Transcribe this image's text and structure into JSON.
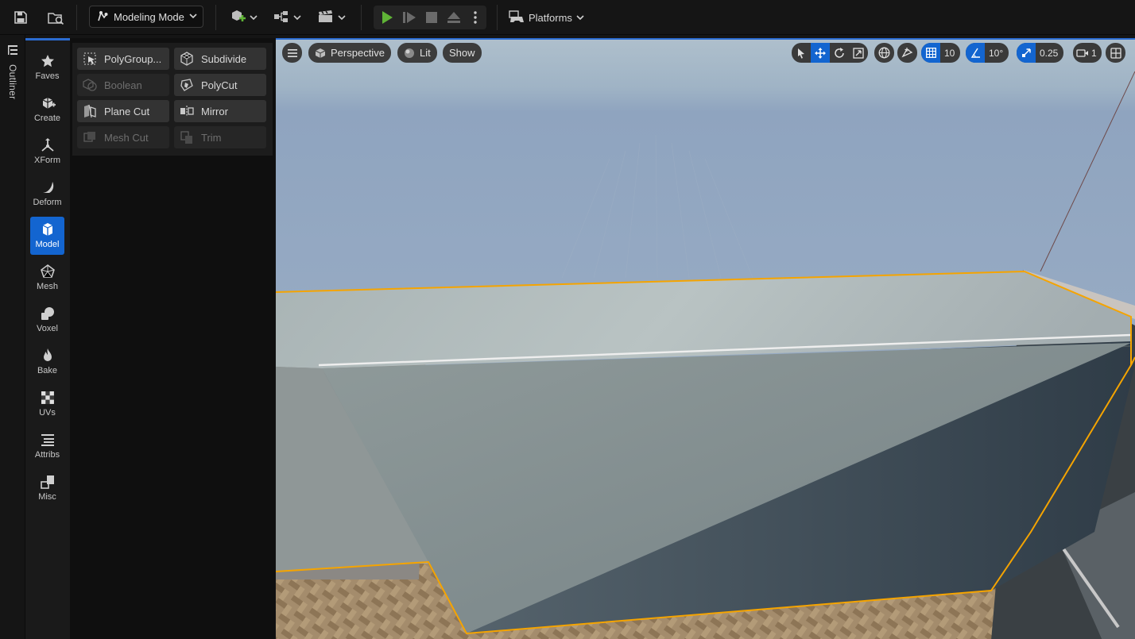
{
  "toolbar": {
    "mode_label": "Modeling Mode",
    "platforms_label": "Platforms"
  },
  "rail": {
    "outliner_label": "Outliner"
  },
  "modes": [
    {
      "label": "Faves",
      "icon": "star-icon"
    },
    {
      "label": "Create",
      "icon": "create-icon"
    },
    {
      "label": "XForm",
      "icon": "xform-icon"
    },
    {
      "label": "Deform",
      "icon": "deform-icon"
    },
    {
      "label": "Model",
      "icon": "model-icon",
      "active": true
    },
    {
      "label": "Mesh",
      "icon": "mesh-icon"
    },
    {
      "label": "Voxel",
      "icon": "voxel-icon"
    },
    {
      "label": "Bake",
      "icon": "bake-icon"
    },
    {
      "label": "UVs",
      "icon": "uvs-icon"
    },
    {
      "label": "Attribs",
      "icon": "attribs-icon"
    },
    {
      "label": "Misc",
      "icon": "misc-icon"
    }
  ],
  "tools": [
    {
      "label": "PolyGroup...",
      "enabled": true
    },
    {
      "label": "Subdivide",
      "enabled": true
    },
    {
      "label": "Boolean",
      "enabled": false
    },
    {
      "label": "PolyCut",
      "enabled": true
    },
    {
      "label": "Plane Cut",
      "enabled": true
    },
    {
      "label": "Mirror",
      "enabled": true
    },
    {
      "label": "Mesh Cut",
      "enabled": false
    },
    {
      "label": "Trim",
      "enabled": false
    }
  ],
  "viewport": {
    "view_label": "Perspective",
    "lit_label": "Lit",
    "show_label": "Show",
    "grid_snap": "10",
    "rotation_snap": "10°",
    "scale_snap": "0.25",
    "camera_speed": "1"
  },
  "colors": {
    "accent": "#1365d0",
    "selection_outline": "#f5a400",
    "play_green": "#5fb336"
  }
}
